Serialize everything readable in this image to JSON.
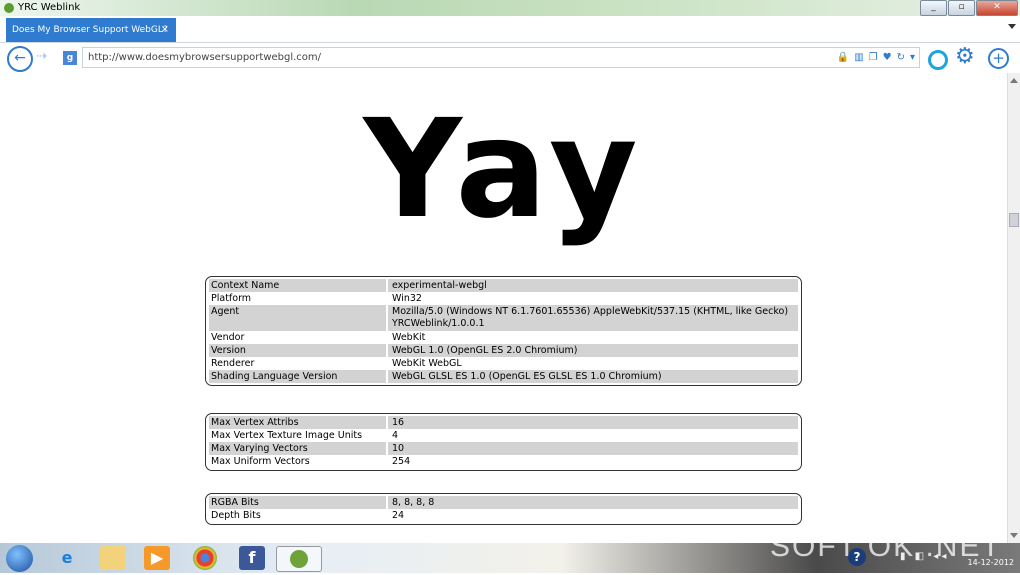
{
  "window": {
    "title": "YRC Weblink",
    "minimize": "_",
    "maximize": "▫",
    "close": "✕"
  },
  "tab": {
    "label": "Does My Browser Support WebGL?",
    "close": "×"
  },
  "toolbar": {
    "back": "←",
    "forward": "⇢",
    "search_engine": "g",
    "url": "http://www.doesmybrowsersupportwebgl.com/",
    "url_icons": [
      "🔒",
      "▥",
      "❐",
      "♥",
      "↻",
      "▾"
    ],
    "gear": "⚙",
    "plus": "+"
  },
  "page": {
    "headline": "Yay",
    "table1": [
      {
        "k": "Context Name",
        "v": "experimental-webgl"
      },
      {
        "k": "Platform",
        "v": "Win32"
      },
      {
        "k": "Agent",
        "v": "Mozilla/5.0 (Windows NT 6.1.7601.65536) AppleWebKit/537.15 (KHTML, like Gecko) YRCWeblink/1.0.0.1"
      },
      {
        "k": "Vendor",
        "v": "WebKit"
      },
      {
        "k": "Version",
        "v": "WebGL 1.0 (OpenGL ES 2.0 Chromium)"
      },
      {
        "k": "Renderer",
        "v": "WebKit WebGL"
      },
      {
        "k": "Shading Language Version",
        "v": "WebGL GLSL ES 1.0 (OpenGL ES GLSL ES 1.0 Chromium)"
      }
    ],
    "table2": [
      {
        "k": "Max Vertex Attribs",
        "v": "16"
      },
      {
        "k": "Max Vertex Texture Image Units",
        "v": "4"
      },
      {
        "k": "Max Varying Vectors",
        "v": "10"
      },
      {
        "k": "Max Uniform Vectors",
        "v": "254"
      }
    ],
    "table3": [
      {
        "k": "RGBA Bits",
        "v": "8, 8, 8, 8"
      },
      {
        "k": "Depth Bits",
        "v": "24"
      }
    ]
  },
  "taskbar": {
    "ie": "e",
    "facebook": "f",
    "help": "?",
    "clock_date": "14-12-2012"
  },
  "watermark": "SOFT OK .NET"
}
